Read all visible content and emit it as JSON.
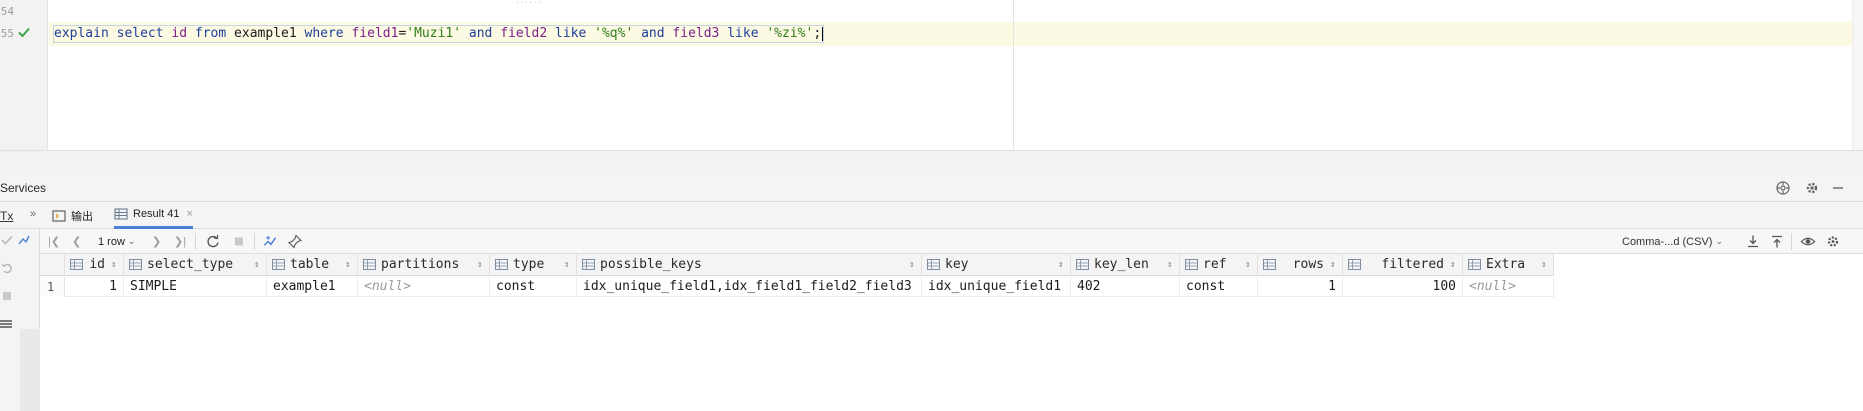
{
  "editor": {
    "line_numbers": [
      "54",
      "55"
    ],
    "code_tokens": [
      {
        "t": "explain",
        "k": "kw"
      },
      {
        "t": " ",
        "k": "plain"
      },
      {
        "t": "select",
        "k": "kw"
      },
      {
        "t": " ",
        "k": "plain"
      },
      {
        "t": "id",
        "k": "col"
      },
      {
        "t": " ",
        "k": "plain"
      },
      {
        "t": "from",
        "k": "kw"
      },
      {
        "t": " example1 ",
        "k": "plain"
      },
      {
        "t": "where",
        "k": "kw"
      },
      {
        "t": " ",
        "k": "plain"
      },
      {
        "t": "field1",
        "k": "col"
      },
      {
        "t": "=",
        "k": "plain"
      },
      {
        "t": "'Muzi1'",
        "k": "str"
      },
      {
        "t": " ",
        "k": "plain"
      },
      {
        "t": "and",
        "k": "kw"
      },
      {
        "t": " ",
        "k": "plain"
      },
      {
        "t": "field2",
        "k": "col"
      },
      {
        "t": " ",
        "k": "plain"
      },
      {
        "t": "like",
        "k": "kw"
      },
      {
        "t": " ",
        "k": "plain"
      },
      {
        "t": "'%q%'",
        "k": "str"
      },
      {
        "t": " ",
        "k": "plain"
      },
      {
        "t": "and",
        "k": "kw"
      },
      {
        "t": " ",
        "k": "plain"
      },
      {
        "t": "field3",
        "k": "col"
      },
      {
        "t": " ",
        "k": "plain"
      },
      {
        "t": "like",
        "k": "kw"
      },
      {
        "t": " ",
        "k": "plain"
      },
      {
        "t": "'%zi%'",
        "k": "str"
      },
      {
        "t": ";",
        "k": "plain"
      }
    ],
    "status_icon": "check-icon"
  },
  "services": {
    "title": "Services",
    "icons": [
      "globe-icon",
      "gear-icon",
      "minimize-icon"
    ]
  },
  "tabs": {
    "tx_label": "Tx",
    "expand_label": "»",
    "output_label": "输出",
    "result_label": "Result 41",
    "close_label": "×"
  },
  "toolbar": {
    "rows_label": "1 row",
    "format_label": "Comma-...d (CSV)",
    "icons": [
      "first-page-icon",
      "prev-page-icon",
      "next-page-icon",
      "last-page-icon",
      "refresh-icon",
      "stop-icon",
      "compare-icon",
      "pin-icon",
      "export-icon",
      "import-icon",
      "view-icon",
      "settings-icon"
    ]
  },
  "grid": {
    "columns": [
      {
        "name": "id",
        "align": "right"
      },
      {
        "name": "select_type",
        "align": "left"
      },
      {
        "name": "table",
        "align": "left"
      },
      {
        "name": "partitions",
        "align": "left"
      },
      {
        "name": "type",
        "align": "left"
      },
      {
        "name": "possible_keys",
        "align": "left"
      },
      {
        "name": "key",
        "align": "left"
      },
      {
        "name": "key_len",
        "align": "left"
      },
      {
        "name": "ref",
        "align": "left"
      },
      {
        "name": "rows",
        "align": "right"
      },
      {
        "name": "filtered",
        "align": "right"
      },
      {
        "name": "Extra",
        "align": "left"
      }
    ],
    "rows": [
      {
        "num": "1",
        "cells": [
          "1",
          "SIMPLE",
          "example1",
          "<null>",
          "const",
          "idx_unique_field1,idx_field1_field2_field3",
          "idx_unique_field1",
          "402",
          "const",
          "1",
          "100",
          "<null>"
        ]
      }
    ],
    "null_token": "<null>"
  },
  "colors": {
    "keyword": "#1f3e9c",
    "column": "#7a1f8a",
    "string": "#2f7d1a",
    "active_line": "#fcfae3",
    "accent_tab": "#4a7fd6"
  }
}
